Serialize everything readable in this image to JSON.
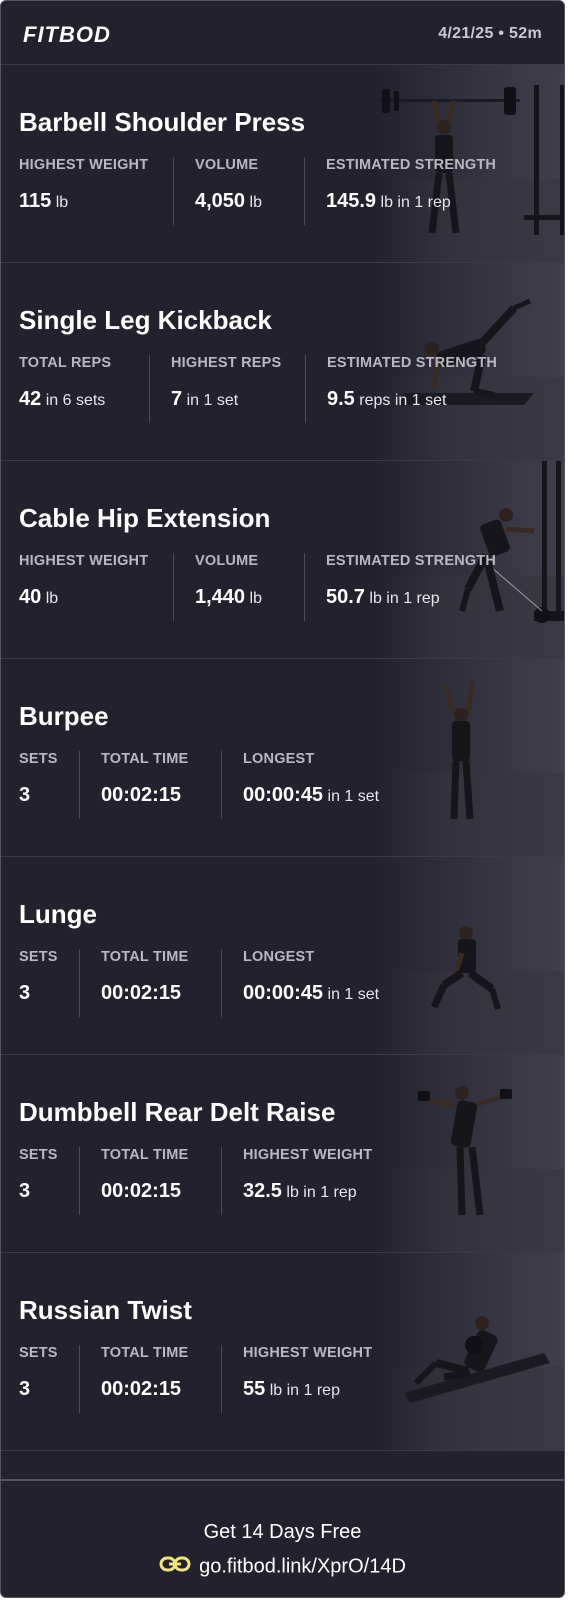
{
  "header": {
    "logo": "FITBOD",
    "meta": "4/21/25 • 52m"
  },
  "exercises": [
    {
      "name": "Barbell Shoulder Press",
      "stats": [
        {
          "label": "HIGHEST WEIGHT",
          "value": "115",
          "unit": "lb"
        },
        {
          "label": "VOLUME",
          "value": "4,050",
          "unit": "lb"
        },
        {
          "label": "ESTIMATED STRENGTH",
          "value": "145.9",
          "unit": "lb in 1 rep"
        }
      ]
    },
    {
      "name": "Single Leg Kickback",
      "stats": [
        {
          "label": "TOTAL REPS",
          "value": "42",
          "unit": "in 6 sets"
        },
        {
          "label": "HIGHEST REPS",
          "value": "7",
          "unit": "in 1 set"
        },
        {
          "label": "ESTIMATED STRENGTH",
          "value": "9.5",
          "unit": "reps in 1 set"
        }
      ]
    },
    {
      "name": "Cable Hip Extension",
      "stats": [
        {
          "label": "HIGHEST WEIGHT",
          "value": "40",
          "unit": "lb"
        },
        {
          "label": "VOLUME",
          "value": "1,440",
          "unit": "lb"
        },
        {
          "label": "ESTIMATED STRENGTH",
          "value": "50.7",
          "unit": "lb in 1 rep"
        }
      ]
    },
    {
      "name": "Burpee",
      "stats": [
        {
          "label": "SETS",
          "value": "3",
          "unit": ""
        },
        {
          "label": "TOTAL TIME",
          "value": "00:02:15",
          "unit": ""
        },
        {
          "label": "LONGEST",
          "value": "00:00:45",
          "unit": "in 1 set"
        }
      ]
    },
    {
      "name": "Lunge",
      "stats": [
        {
          "label": "SETS",
          "value": "3",
          "unit": ""
        },
        {
          "label": "TOTAL TIME",
          "value": "00:02:15",
          "unit": ""
        },
        {
          "label": "LONGEST",
          "value": "00:00:45",
          "unit": "in 1 set"
        }
      ]
    },
    {
      "name": "Dumbbell Rear Delt Raise",
      "stats": [
        {
          "label": "SETS",
          "value": "3",
          "unit": ""
        },
        {
          "label": "TOTAL TIME",
          "value": "00:02:15",
          "unit": ""
        },
        {
          "label": "HIGHEST WEIGHT",
          "value": "32.5",
          "unit": "lb in 1 rep"
        }
      ]
    },
    {
      "name": "Russian Twist",
      "stats": [
        {
          "label": "SETS",
          "value": "3",
          "unit": ""
        },
        {
          "label": "TOTAL TIME",
          "value": "00:02:15",
          "unit": ""
        },
        {
          "label": "HIGHEST WEIGHT",
          "value": "55",
          "unit": "lb in 1 rep"
        }
      ]
    }
  ],
  "footer": {
    "cta": "Get 14 Days Free",
    "link_icon": "link-icon",
    "link": "go.fitbod.link/XprO/14D",
    "link_icon_color": "#f4e27a"
  }
}
